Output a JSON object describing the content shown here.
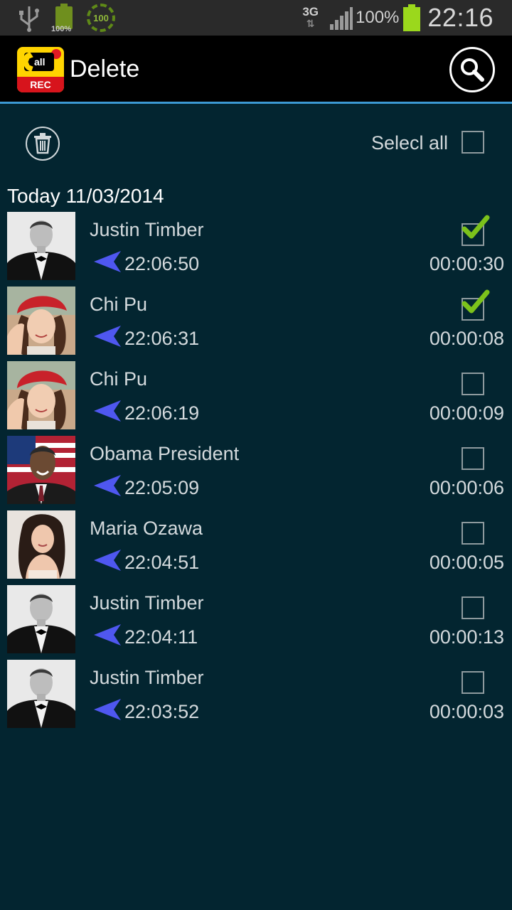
{
  "status_bar": {
    "battery_small_text": "100%",
    "circle_badge": "100",
    "network": "3G",
    "battery_percent": "100%",
    "time": "22:16"
  },
  "action_bar": {
    "logo_call_text": "all",
    "logo_rec_text": "REC",
    "title": "Delete"
  },
  "toolbar": {
    "select_all_label": "Selecl all"
  },
  "date_header": "Today 11/03/2014",
  "colors": {
    "background": "#032530",
    "accent_line": "#3c9ad4",
    "call_arrow": "#4f57f0",
    "check_green": "#7cc21b"
  },
  "calls": [
    {
      "name": "Justin Timber",
      "time": "22:06:50",
      "duration": "00:00:30",
      "checked": true,
      "avatar": "man-in-tuxedo"
    },
    {
      "name": "Chi Pu",
      "time": "22:06:31",
      "duration": "00:00:08",
      "checked": true,
      "avatar": "girl-red-hat"
    },
    {
      "name": "Chi Pu",
      "time": "22:06:19",
      "duration": "00:00:09",
      "checked": false,
      "avatar": "girl-red-hat"
    },
    {
      "name": "Obama President",
      "time": "22:05:09",
      "duration": "00:00:06",
      "checked": false,
      "avatar": "man-flag"
    },
    {
      "name": "Maria Ozawa",
      "time": "22:04:51",
      "duration": "00:00:05",
      "checked": false,
      "avatar": "woman-dark-hair"
    },
    {
      "name": "Justin Timber",
      "time": "22:04:11",
      "duration": "00:00:13",
      "checked": false,
      "avatar": "man-in-tuxedo"
    },
    {
      "name": "Justin Timber",
      "time": "22:03:52",
      "duration": "00:00:03",
      "checked": false,
      "avatar": "man-in-tuxedo"
    }
  ]
}
